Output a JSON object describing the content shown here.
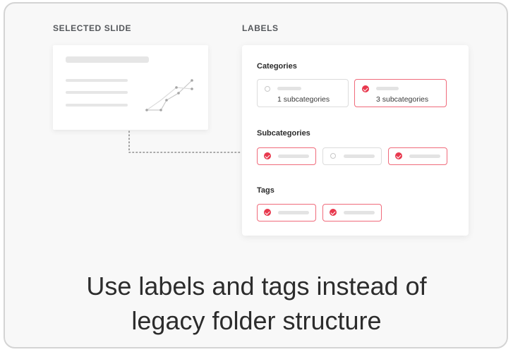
{
  "sections": {
    "selected_slide_label": "SELECTED SLIDE",
    "labels_label": "LABELS"
  },
  "panel": {
    "categories": {
      "title": "Categories",
      "options": [
        {
          "text": "1 subcategories",
          "selected": false
        },
        {
          "text": "3 subcategories",
          "selected": true
        }
      ]
    },
    "subcategories": {
      "title": "Subcategories",
      "chips": [
        {
          "selected": true
        },
        {
          "selected": false
        },
        {
          "selected": true
        }
      ]
    },
    "tags": {
      "title": "Tags",
      "chips": [
        {
          "selected": true
        },
        {
          "selected": true
        }
      ]
    }
  },
  "caption": {
    "line1": "Use labels and tags instead of",
    "line2": "legacy folder structure"
  },
  "colors": {
    "accent": "#e8394e",
    "accent_border": "#f06b7b",
    "caption_text": "#2c2c2c"
  }
}
